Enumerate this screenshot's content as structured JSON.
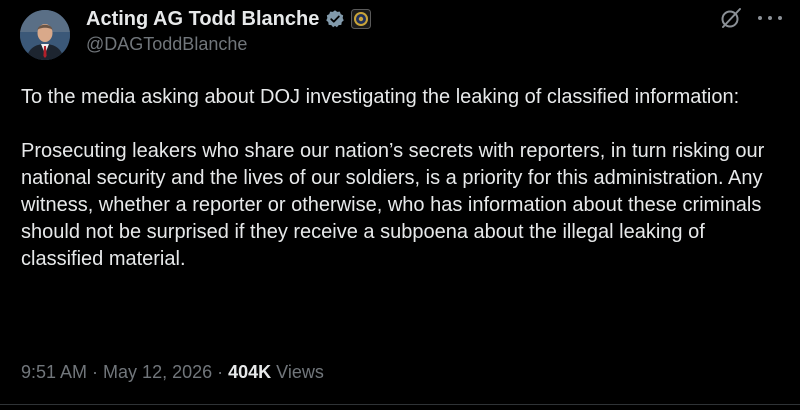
{
  "author": {
    "display_name": "Acting AG Todd Blanche",
    "handle": "@DAGToddBlanche",
    "verified_icon": "verified-badge-icon",
    "affiliate_icon": "doj-seal-icon"
  },
  "post": {
    "paragraph_1": "To the media asking about DOJ investigating the leaking of classified information:",
    "paragraph_2": "Prosecuting leakers who share our nation’s secrets with reporters, in turn risking our national security and the lives of our soldiers, is a priority for this administration. Any witness, whether a reporter or otherwise, who has information about these criminals should not be surprised if they receive a subpoena about the illegal leaking of classified material."
  },
  "meta": {
    "time": "9:51 AM",
    "separator": " · ",
    "date": "May 12, 2026",
    "views_count": "404K",
    "views_label": "Views"
  },
  "colors": {
    "background": "#000000",
    "text_primary": "#e7e9ea",
    "text_secondary": "#71767b",
    "verified": "#829aab"
  }
}
